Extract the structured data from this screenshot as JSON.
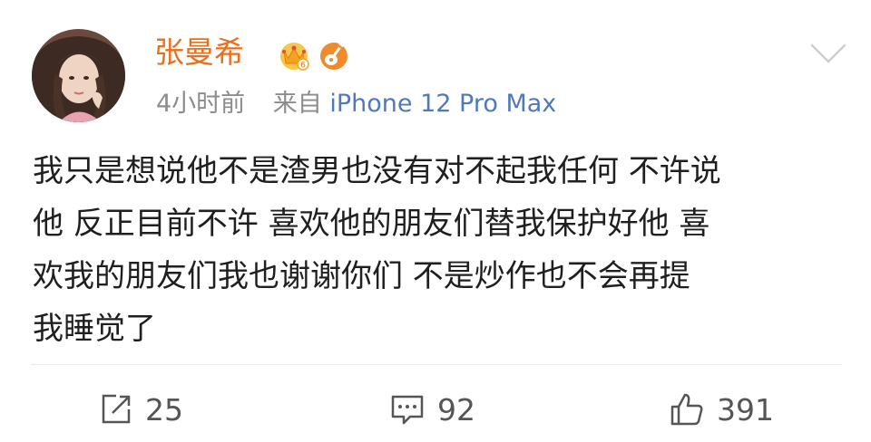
{
  "post": {
    "author": {
      "name": "张曼希",
      "avatar_icon": "avatar-photo",
      "badges": [
        "crown-badge-icon",
        "guitar-icon"
      ]
    },
    "meta": {
      "time": "4小时前",
      "source_prefix": "来自",
      "device": "iPhone 12 Pro Max"
    },
    "content_lines": [
      "我只是想说他不是渣男也没有对不起我任何 不许说",
      "他 反正目前不许 喜欢他的朋友们替我保护好他 喜",
      "欢我的朋友们我也谢谢你们 不是炒作也不会再提",
      "我睡觉了"
    ],
    "actions": {
      "repost_count": "25",
      "comment_count": "92",
      "like_count": "391"
    }
  },
  "colors": {
    "author_name": "#e86f1c",
    "meta_text": "#8c8c8c",
    "device_link": "#4f79b8",
    "body_text": "#1f1f1f",
    "action_text": "#555555"
  }
}
